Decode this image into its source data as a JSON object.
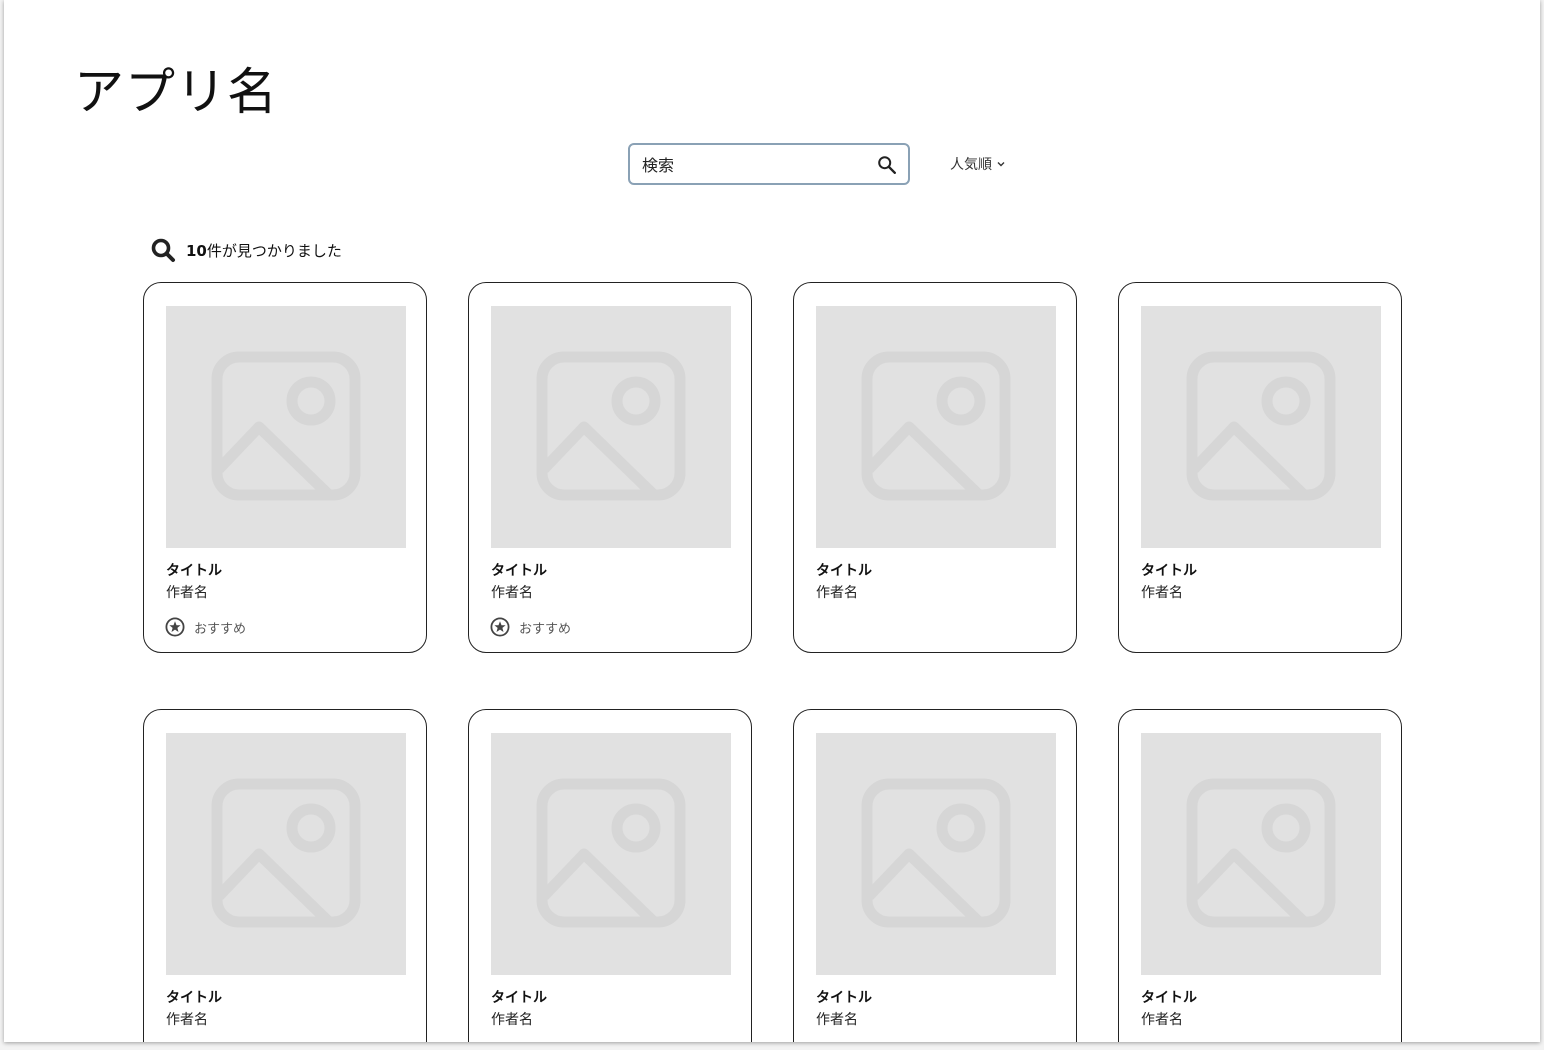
{
  "header": {
    "app_title": "アプリ名"
  },
  "search": {
    "placeholder": "検索",
    "value": ""
  },
  "sort": {
    "selected": "人気順"
  },
  "results": {
    "count": "10",
    "suffix": "件が見つかりました"
  },
  "cards": [
    {
      "title": "タイトル",
      "author": "作者名",
      "badge": "おすすめ"
    },
    {
      "title": "タイトル",
      "author": "作者名",
      "badge": "おすすめ"
    },
    {
      "title": "タイトル",
      "author": "作者名",
      "badge": null
    },
    {
      "title": "タイトル",
      "author": "作者名",
      "badge": null
    },
    {
      "title": "タイトル",
      "author": "作者名",
      "badge": null
    },
    {
      "title": "タイトル",
      "author": "作者名",
      "badge": null
    },
    {
      "title": "タイトル",
      "author": "作者名",
      "badge": null
    },
    {
      "title": "タイトル",
      "author": "作者名",
      "badge": null
    }
  ],
  "colors": {
    "placeholder_bg": "#e1e1e1",
    "placeholder_icon": "#d6d6d6",
    "search_border": "#8aa1b5"
  },
  "icons": {
    "search": "search-icon",
    "sort": "chevron-down-icon",
    "results": "search-icon",
    "image": "image-placeholder-icon",
    "badge": "star-circle-icon"
  }
}
